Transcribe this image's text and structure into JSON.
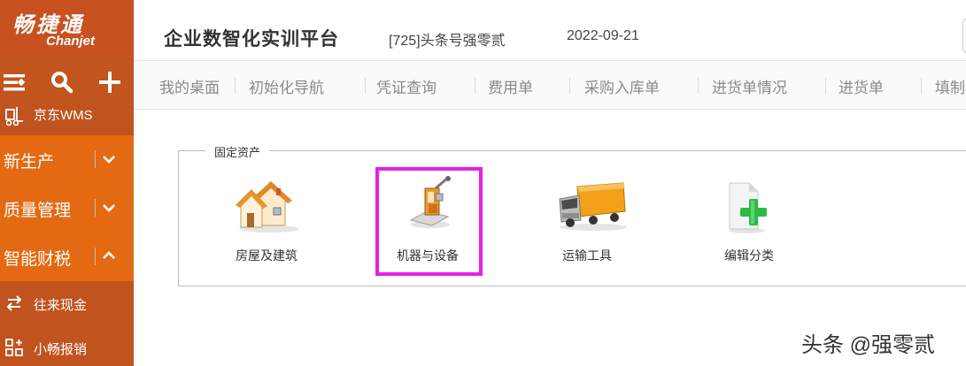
{
  "logo": {
    "cn": "畅捷通",
    "en": "Chanjet"
  },
  "header": {
    "title": "企业数智化实训平台",
    "user": "[725]头条号强零贰",
    "date": "2022-09-21"
  },
  "sidebar": {
    "toolbar": {
      "menu_icon": "menu-icon",
      "search_icon": "search-icon",
      "add_icon": "plus-icon"
    },
    "top_item": {
      "label": "京东WMS",
      "icon": "forklift-icon"
    },
    "menus": [
      {
        "label": "新生产",
        "expanded": false
      },
      {
        "label": "质量管理",
        "expanded": false
      },
      {
        "label": "智能财税",
        "expanded": true
      }
    ],
    "subitems": [
      {
        "label": "往来现金",
        "icon": "exchange-icon"
      },
      {
        "label": "小畅报销",
        "icon": "grid-plus-icon"
      }
    ]
  },
  "tabs": [
    "我的桌面",
    "初始化导航",
    "凭证查询",
    "费用单",
    "采购入库单",
    "进货单情况",
    "进货单",
    "填制"
  ],
  "fixed_assets": {
    "legend": "固定资产",
    "items": [
      {
        "label": "房屋及建筑",
        "icon": "house-icon"
      },
      {
        "label": "机器与设备",
        "icon": "machine-icon",
        "selected": true
      },
      {
        "label": "运输工具",
        "icon": "truck-icon"
      },
      {
        "label": "编辑分类",
        "icon": "add-document-icon"
      }
    ]
  },
  "watermark": "头条 @强零贰",
  "colors": {
    "sidebar": "#c1531e",
    "menu_bg": "#e36a12",
    "highlight": "#e620e6"
  }
}
